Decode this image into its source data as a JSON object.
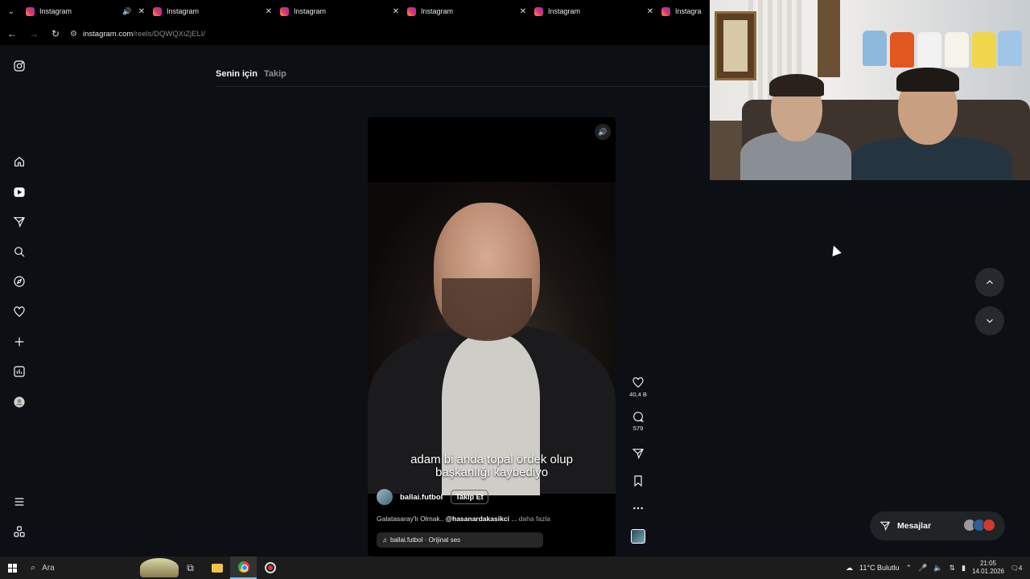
{
  "browser": {
    "tabs": [
      {
        "title": "Instagram",
        "audio": true
      },
      {
        "title": "Instagram",
        "audio": false
      },
      {
        "title": "Instagram",
        "audio": false
      },
      {
        "title": "Instagram",
        "audio": false
      },
      {
        "title": "Instagram",
        "audio": false
      },
      {
        "title": "Instagram",
        "audio": false
      }
    ],
    "url_host": "instagram.com",
    "url_path": "/reels/DQWQXiZjELI/"
  },
  "feed": {
    "tab_for_you": "Senin için",
    "tab_following": "Takip"
  },
  "reel": {
    "subtitle_line1": "adam bi anda topal ördek olup",
    "subtitle_line2": "başkanlığı kaybediyo",
    "author": "ballai.futbol",
    "follow_label": "Takip Et",
    "caption_text": "Galatasaray'lı Olmak.. ",
    "caption_mention": "@hasanardakasikci",
    "caption_ellipsis": " ... ",
    "caption_more": "daha fazla",
    "audio_label": "ballai.futbol · Orijinal ses",
    "likes": "40,4 B",
    "comments": "579"
  },
  "messages": {
    "label": "Mesajlar"
  },
  "taskbar": {
    "search_placeholder": "Ara",
    "weather": "11°C  Bulutlu",
    "time": "21:05",
    "date": "14.01.2026",
    "notifications": "4"
  },
  "colors": {
    "background": "#0c1014",
    "instagram_gradient": [
      "#f9a23a",
      "#e1306c",
      "#8a3ab9"
    ]
  }
}
